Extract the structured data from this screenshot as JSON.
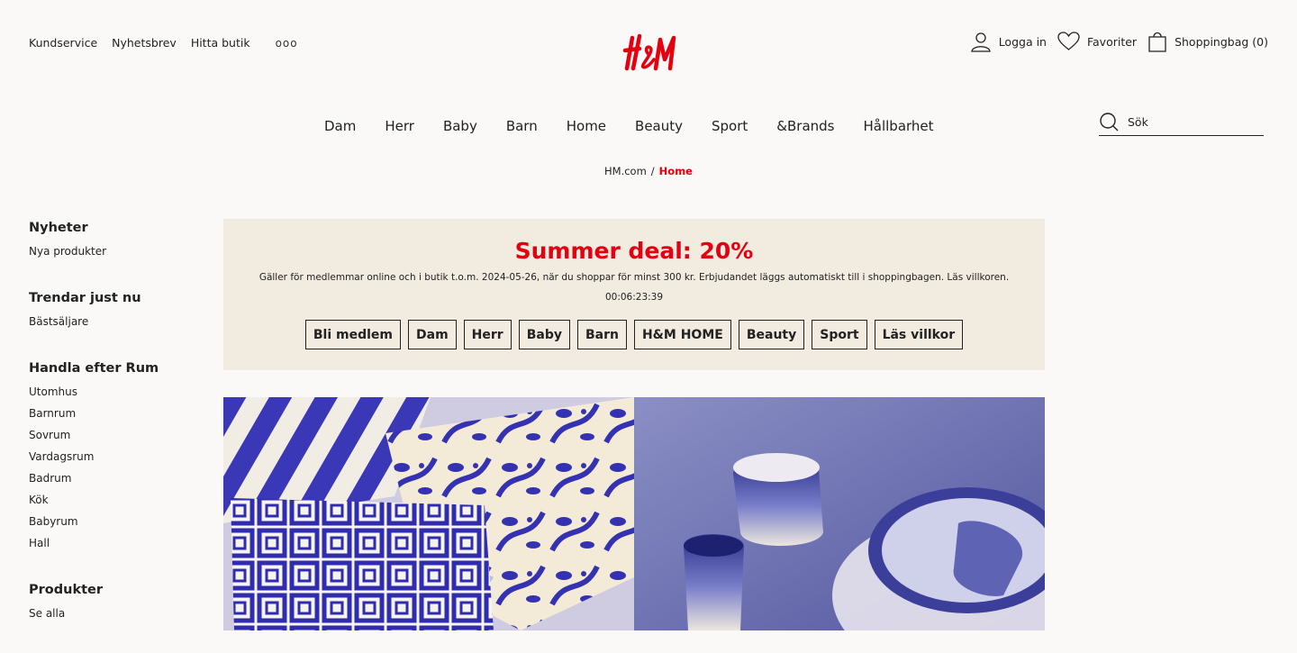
{
  "utility_nav": [
    "Kundservice",
    "Nyhetsbrev",
    "Hitta butik"
  ],
  "more_dots": "ooo",
  "account": {
    "login": "Logga in",
    "favorites": "Favoriter",
    "bag": "Shoppingbag (0)"
  },
  "main_nav": [
    "Dam",
    "Herr",
    "Baby",
    "Barn",
    "Home",
    "Beauty",
    "Sport",
    "&Brands",
    "Hållbarhet"
  ],
  "search": {
    "placeholder": "Sök"
  },
  "breadcrumb": {
    "root": "HM.com",
    "separator": "/",
    "current": "Home"
  },
  "sidebar": [
    {
      "heading": "Nyheter",
      "links": [
        "Nya produkter"
      ]
    },
    {
      "heading": "Trendar just nu",
      "links": [
        "Bästsäljare"
      ]
    },
    {
      "heading": "Handla efter Rum",
      "links": [
        "Utomhus",
        "Barnrum",
        "Sovrum",
        "Vardagsrum",
        "Badrum",
        "Kök",
        "Babyrum",
        "Hall"
      ]
    },
    {
      "heading": "Produkter",
      "links": [
        "Se alla"
      ]
    }
  ],
  "promo": {
    "title": "Summer deal: 20%",
    "subtitle": "Gäller för medlemmar online och i butik t.o.m. 2024-05-26, när du shoppar för minst 300 kr. Erbjudandet läggs automatiskt till i shoppingbagen. Läs villkoren.",
    "timer": "00:06:23:39",
    "buttons": [
      "Bli medlem",
      "Dam",
      "Herr",
      "Baby",
      "Barn",
      "H&M HOME",
      "Beauty",
      "Sport",
      "Läs villkor"
    ]
  },
  "colors": {
    "brand_red": "#e50010",
    "promo_bg": "#f1ebe0",
    "page_bg": "#faf9f8"
  }
}
